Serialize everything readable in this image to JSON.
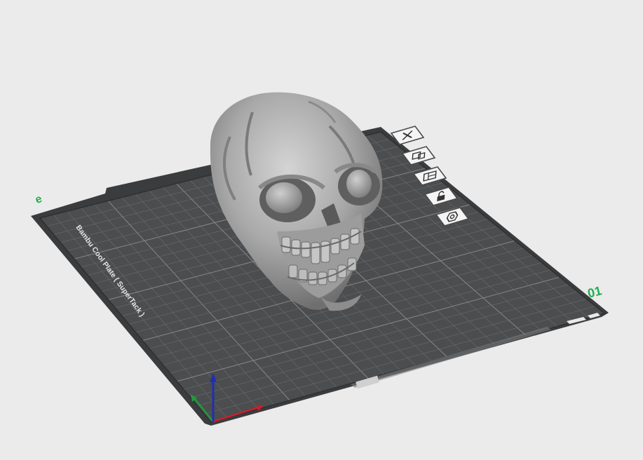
{
  "plate": {
    "label": "Bambu Cool Plate ( SuperTack )",
    "plate_number": "01",
    "corner_mark": "e",
    "colors": {
      "surface": "#4b4d4f",
      "grid": "#6a6c6e",
      "major_grid": "#86888a",
      "edge": "#2f3133",
      "frame": "#3a3c3e",
      "accent": "#1fae4f"
    }
  },
  "axes": {
    "x_color": "#c8202a",
    "y_color": "#1e9c3a",
    "z_color": "#1f2fb4"
  },
  "model": {
    "name": "skull-model",
    "color": "#a9a9a9"
  },
  "plate_toolbar": [
    {
      "name": "delete-plate-button",
      "icon": "close-icon"
    },
    {
      "name": "arrange-button",
      "icon": "arrange-icon"
    },
    {
      "name": "orient-button",
      "icon": "layout-icon"
    },
    {
      "name": "lock-plate-button",
      "icon": "lock-icon"
    },
    {
      "name": "plate-settings-button",
      "icon": "gear-icon"
    }
  ]
}
